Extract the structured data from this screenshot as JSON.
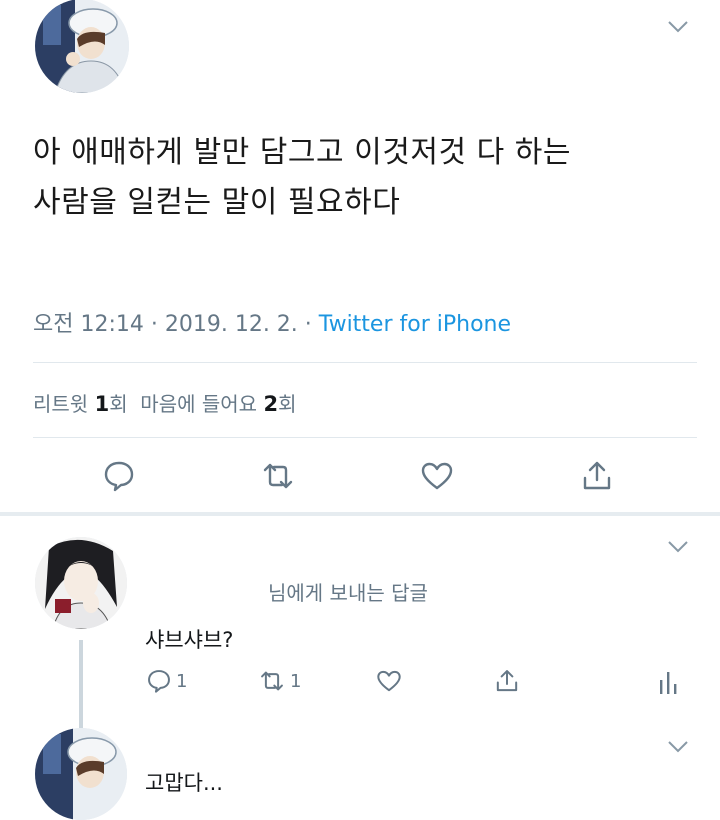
{
  "tweet": {
    "line1": "아 애매하게 발만 담그고 이것저것 다 하는",
    "line2": "사람을 일컫는 말이 필요하다",
    "time": "오전 12:14 · 2019. 12. 2. · ",
    "source": "Twitter for iPhone",
    "retweet_label": "리트윗 ",
    "retweet_count": "1",
    "retweet_unit": "회",
    "like_label": "  마음에 들어요 ",
    "like_count": "2",
    "like_unit": "회"
  },
  "reply": {
    "to_handle": "",
    "to_suffix": "님에게 보내는 답글",
    "text": "샤브샤브?",
    "reply_count": "1",
    "retweet_count": "1"
  },
  "reply2": {
    "text": "고맙다..."
  },
  "icons": {
    "reply": "speech-bubble-icon",
    "retweet": "retweet-icon",
    "like": "heart-icon",
    "share": "share-icon",
    "analytics": "analytics-icon",
    "more": "chevron-down-icon"
  },
  "colors": {
    "link": "#1b95e0",
    "muted": "#657786",
    "icon": "#657786"
  }
}
